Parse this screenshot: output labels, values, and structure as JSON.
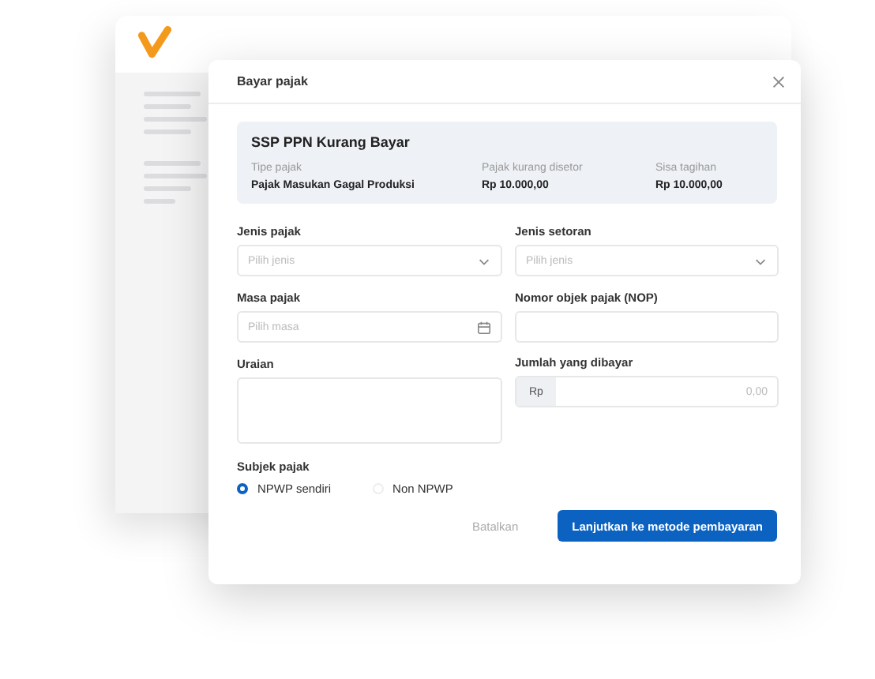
{
  "dialog": {
    "title": "Bayar pajak",
    "summary": {
      "title": "SSP PPN Kurang Bayar",
      "items": [
        {
          "label": "Tipe pajak",
          "value": "Pajak Masukan Gagal Produksi"
        },
        {
          "label": "Pajak kurang disetor",
          "value": "Rp 10.000,00"
        },
        {
          "label": "Sisa tagihan",
          "value": "Rp 10.000,00"
        }
      ]
    },
    "fields": [
      {
        "kind": "select",
        "label": "Jenis pajak",
        "placeholder": "Pilih jenis"
      },
      {
        "kind": "select",
        "label": "Jenis setoran",
        "placeholder": "Pilih jenis"
      },
      {
        "kind": "date",
        "label": "Masa pajak",
        "placeholder": "Pilih masa"
      },
      {
        "kind": "text",
        "label": "Nomor objek pajak (NOP)"
      },
      {
        "kind": "textarea",
        "label": "Uraian"
      },
      {
        "kind": "money",
        "label": "Jumlah yang dibayar",
        "prefix": "Rp",
        "placeholder": "0,00"
      }
    ],
    "subject": {
      "label": "Subjek pajak",
      "options": [
        {
          "label": "NPWP sendiri",
          "selected": true
        },
        {
          "label": "Non NPWP",
          "selected": false
        }
      ]
    },
    "buttons": [
      {
        "kind": "secondary",
        "label": "Batalkan"
      },
      {
        "kind": "primary",
        "label": "Lanjutkan ke metode pembayaran"
      }
    ]
  }
}
